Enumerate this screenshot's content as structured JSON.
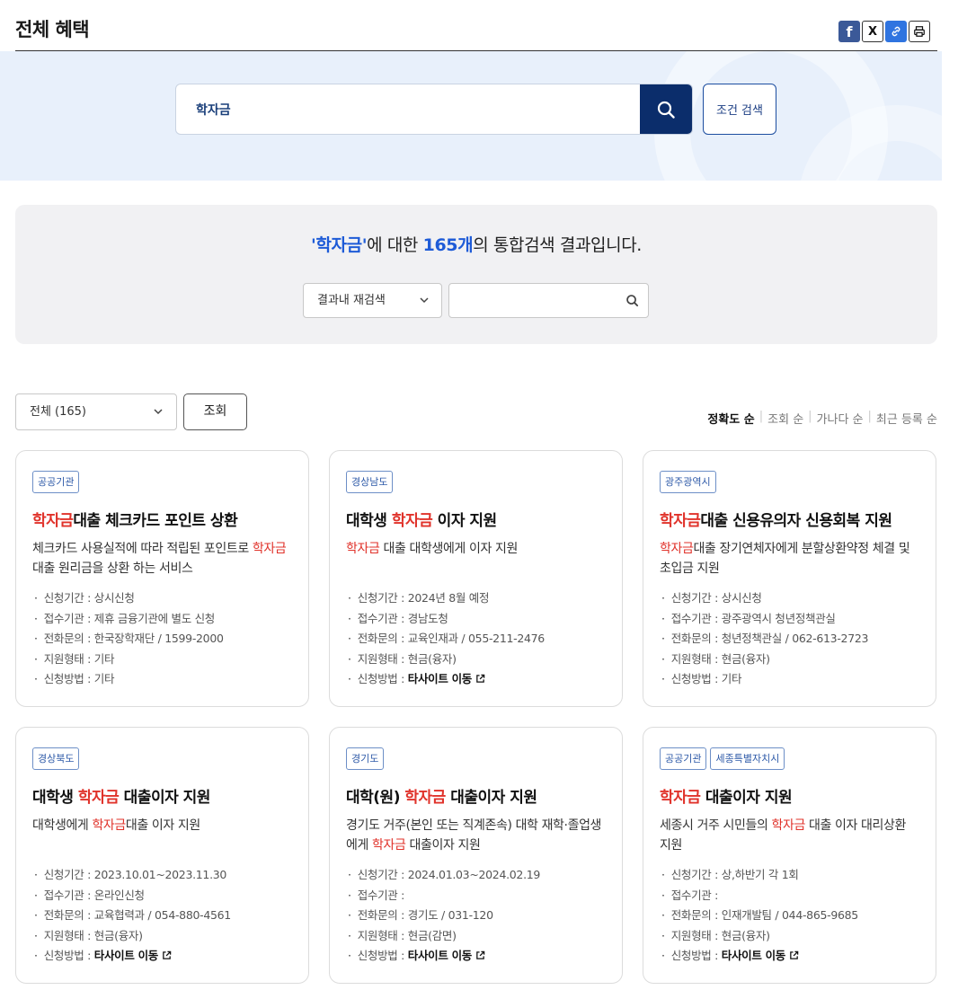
{
  "header": {
    "title": "전체 혜택"
  },
  "share": {
    "facebook": "f",
    "x": "X",
    "link": "🔗",
    "print": "⎙"
  },
  "search": {
    "value": "학자금",
    "condition_button": "조건 검색"
  },
  "result": {
    "keyword": "'학자금'",
    "middle": "에 대한 ",
    "count": "165개",
    "suffix": "의 통합검색 결과입니다.",
    "refine_select": "결과내 재검색"
  },
  "filter": {
    "select": "전체 (165)",
    "query_button": "조회",
    "sort": [
      "정확도 순",
      "조회 순",
      "가나다 순",
      "최근 등록 순"
    ]
  },
  "labels": {
    "period": "신청기간 : ",
    "agency": "접수기관 : ",
    "contact": "전화문의 : ",
    "type": "지원형태 : ",
    "method": "신청방법 : "
  },
  "cards": [
    {
      "tags": [
        "공공기관"
      ],
      "title_pre": "",
      "title_hl": "학자금",
      "title_post": "대출 체크카드 포인트 상환",
      "desc_pre": "체크카드 사용실적에 따라 적립된 포인트로 ",
      "desc_hl": "학자금",
      "desc_post": "대출 원리금을 상환 하는 서비스",
      "period": "상시신청",
      "agency": "제휴 금융기관에 별도 신청",
      "contact": "한국장학재단 / 1599-2000",
      "type": "기타",
      "method": "기타"
    },
    {
      "tags": [
        "경상남도"
      ],
      "title_pre": "대학생 ",
      "title_hl": "학자금",
      "title_post": " 이자 지원",
      "desc_pre": "",
      "desc_hl": "학자금",
      "desc_post": " 대출 대학생에게 이자 지원",
      "period": "2024년 8월 예정",
      "agency": "경남도청",
      "contact": "교육인재과 / 055-211-2476",
      "type": "현금(융자)",
      "method": "타사이트 이동"
    },
    {
      "tags": [
        "광주광역시"
      ],
      "title_pre": "",
      "title_hl": "학자금",
      "title_post": "대출 신용유의자 신용회복 지원",
      "desc_pre": "",
      "desc_hl": "학자금",
      "desc_post": "대출 장기연체자에게 분할상환약정 체결 및 초입금 지원",
      "period": "상시신청",
      "agency": "광주광역시 청년정책관실",
      "contact": "청년정책관실 / 062-613-2723",
      "type": "현금(융자)",
      "method": "기타"
    },
    {
      "tags": [
        "경상북도"
      ],
      "title_pre": "대학생 ",
      "title_hl": "학자금",
      "title_post": " 대출이자 지원",
      "desc_pre": "대학생에게 ",
      "desc_hl": "학자금",
      "desc_post": "대출 이자 지원",
      "period": "2023.10.01~2023.11.30",
      "agency": "온라인신청",
      "contact": "교육협력과 / 054-880-4561",
      "type": "현금(융자)",
      "method": "타사이트 이동"
    },
    {
      "tags": [
        "경기도"
      ],
      "title_pre": "대학(원) ",
      "title_hl": "학자금",
      "title_post": " 대출이자 지원",
      "desc_pre": "경기도 거주(본인 또는 직계존속) 대학 재학·졸업생에게 ",
      "desc_hl": "학자금",
      "desc_post": " 대출이자 지원",
      "period": "2024.01.03~2024.02.19",
      "agency": "",
      "contact": "경기도 / 031-120",
      "type": "현금(감면)",
      "method": "타사이트 이동"
    },
    {
      "tags": [
        "공공기관",
        "세종특별자치시"
      ],
      "title_pre": "",
      "title_hl": "학자금",
      "title_post": " 대출이자 지원",
      "desc_pre": "세종시 거주 시민들의 ",
      "desc_hl": "학자금",
      "desc_post": " 대출 이자 대리상환 지원",
      "period": "상,하반기 각 1회",
      "agency": "",
      "contact": "인재개발팀 / 044-865-9685",
      "type": "현금(융자)",
      "method": "타사이트 이동"
    }
  ]
}
